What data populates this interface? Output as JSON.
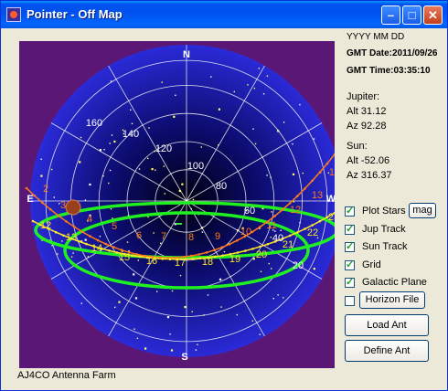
{
  "window": {
    "title": "Pointer - Off Map",
    "min_symbol": "–",
    "max_symbol": "□",
    "close_symbol": "✕"
  },
  "plot": {
    "directions": {
      "north": "N",
      "south": "S",
      "east": "E",
      "west": "W"
    },
    "altitude_labels": [
      "160",
      "140",
      "120",
      "100",
      "80",
      "60",
      "40",
      "20"
    ],
    "jupiter_track_labels": [
      "2",
      "3",
      "4",
      "5",
      "6",
      "7",
      "8",
      "9",
      "10",
      "11",
      "12",
      "13",
      "14"
    ],
    "sun_track_labels": [
      "12",
      "13",
      "14",
      "15",
      "16",
      "17",
      "18",
      "19",
      "20",
      "21",
      "22",
      "23"
    ],
    "colors": {
      "background": "#5b1776",
      "sky": "#2a2ad8",
      "grid": "#ffffff",
      "galactic_plane": "#20f020",
      "jupiter_track": "#ff7a1a",
      "sun_track": "#ffe82a"
    }
  },
  "datetime": {
    "format_hint": "YYYY MM DD",
    "date_label": "GMT Date:",
    "date": "2011/09/26",
    "time_label": "GMT Time:",
    "time": "03:35:10"
  },
  "jupiter": {
    "name": "Jupiter:",
    "alt_label": "Alt",
    "alt": "31.12",
    "az_label": "Az",
    "az": "92.28"
  },
  "sun": {
    "name": "Sun:",
    "alt_label": "Alt",
    "alt": "-52.06",
    "az_label": "Az",
    "az": "316.37"
  },
  "options": {
    "plot_stars": {
      "label": "Plot Stars",
      "checked": true
    },
    "mag_button": "mag",
    "jup_track": {
      "label": "Jup Track",
      "checked": true
    },
    "sun_track": {
      "label": "Sun Track",
      "checked": true
    },
    "grid": {
      "label": "Grid",
      "checked": true
    },
    "galactic_plane": {
      "label": "Galactic Plane",
      "checked": true
    },
    "horizon_file": {
      "checked": false
    },
    "horizon_file_button": "Horizon File"
  },
  "buttons": {
    "load_ant": "Load Ant",
    "define_ant": "Define Ant"
  },
  "status": {
    "text": "AJ4CO Antenna Farm"
  }
}
